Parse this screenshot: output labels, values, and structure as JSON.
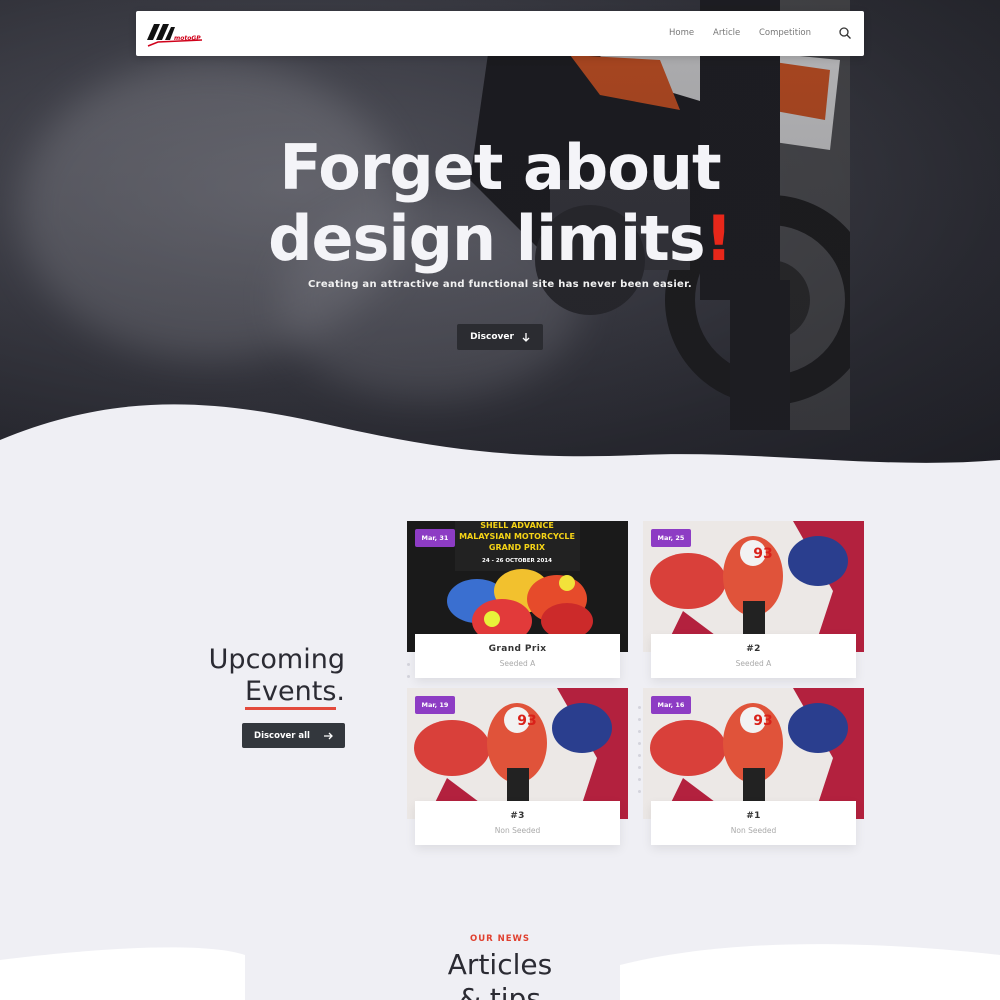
{
  "nav": {
    "logo_text": "motoGP",
    "links": [
      "Home",
      "Article",
      "Competition"
    ]
  },
  "hero": {
    "title_line1": "Forget about",
    "title_line2": "design limits",
    "title_accent": "!",
    "subtitle": "Creating an attractive and functional site has never been easier.",
    "button_label": "Discover"
  },
  "events": {
    "heading_line1": "Upcoming",
    "heading_line2": "Events",
    "heading_period": ".",
    "button_label": "Discover all",
    "cards": [
      {
        "date": "Mar, 31",
        "name": "Grand Prix",
        "seed": "Seeded A",
        "poster_lines": [
          "SHELL ADVANCE",
          "MALAYSIAN MOTORCYCLE",
          "GRAND PRIX",
          "24 - 26 OCTOBER 2014"
        ]
      },
      {
        "date": "Mar, 25",
        "name": "#2",
        "seed": "Seeded A"
      },
      {
        "date": "Mar, 19",
        "name": "#3",
        "seed": "Non Seeded"
      },
      {
        "date": "Mar, 16",
        "name": "#1",
        "seed": "Non Seeded"
      }
    ],
    "bike_number": "93"
  },
  "news": {
    "label": "OUR NEWS",
    "title_line1": "Articles",
    "title_line2": "& tips"
  },
  "colors": {
    "accent_red": "#e8271a",
    "badge_purple": "#8d3cc4",
    "dark_button": "#2b2c31"
  }
}
